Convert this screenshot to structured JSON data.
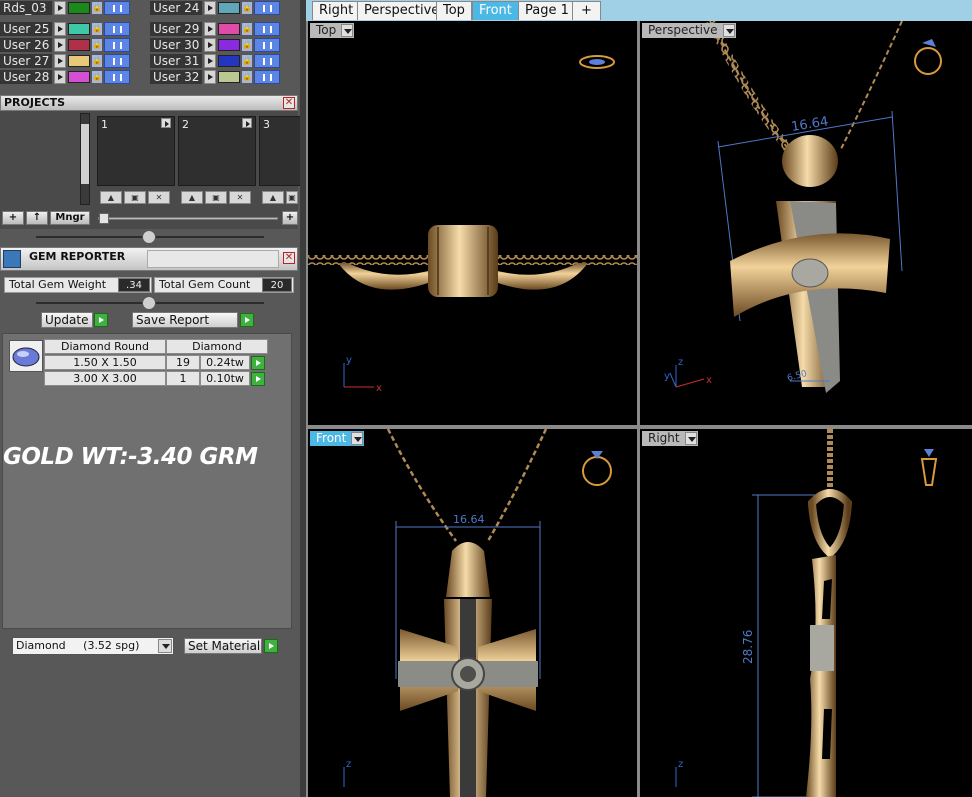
{
  "layers": [
    {
      "left": {
        "name": "Rds_03",
        "color": "#1a8a1a"
      },
      "right": {
        "name": "User 24",
        "color": "#5fa7b9"
      }
    },
    {
      "left": {
        "name": "User 25",
        "color": "#3fc8a8"
      },
      "right": {
        "name": "User 29",
        "color": "#e04aa8"
      }
    },
    {
      "left": {
        "name": "User 26",
        "color": "#b0304a"
      },
      "right": {
        "name": "User 30",
        "color": "#8a2ae0"
      }
    },
    {
      "left": {
        "name": "User 27",
        "color": "#e8c87a"
      },
      "right": {
        "name": "User 31",
        "color": "#2236c0"
      }
    },
    {
      "left": {
        "name": "User 28",
        "color": "#d44fd4"
      },
      "right": {
        "name": "User 32",
        "color": "#b8c890"
      }
    }
  ],
  "projects": {
    "title": "PROJECTS",
    "slots": [
      "1",
      "2",
      "3"
    ],
    "buttons": {
      "add": "+",
      "up": "↑",
      "manager": "Mngr",
      "plus": "+"
    }
  },
  "gem_reporter": {
    "title": "GEM REPORTER",
    "total_weight_label": "Total Gem Weight",
    "total_weight_value": ".34",
    "total_count_label": "Total Gem Count",
    "total_count_value": "20",
    "update_label": "Update",
    "save_report_label": "Save Report",
    "table": {
      "shape_header": "Diamond Round",
      "material_header": "Diamond",
      "rows": [
        {
          "size": "1.50 X 1.50",
          "count": "19",
          "weight": "0.24tw"
        },
        {
          "size": "3.00 X 3.00",
          "count": "1",
          "weight": "0.10tw"
        }
      ]
    },
    "gold_weight_text": "GOLD WT:-3.40 GRM",
    "material_select": "Diamond     (3.52 spg)",
    "set_material_label": "Set Material"
  },
  "tabs": [
    {
      "label": "Right",
      "active": false
    },
    {
      "label": "Perspective",
      "active": false
    },
    {
      "label": "Top",
      "active": false
    },
    {
      "label": "Front",
      "active": true
    },
    {
      "label": "Page 1",
      "active": false
    },
    {
      "label": "+",
      "active": false
    }
  ],
  "viewports": {
    "top": {
      "label": "Top"
    },
    "perspective": {
      "label": "Perspective",
      "dimension": "16.64",
      "dimension_small": "6.50"
    },
    "front": {
      "label": "Front",
      "dimension": "16.64"
    },
    "right": {
      "label": "Right",
      "dimension": "28.76"
    }
  },
  "axes": {
    "x": "x",
    "y": "y",
    "z": "z"
  },
  "colors": {
    "gold": "#c9a26a",
    "silver": "#a8a8a0",
    "dimension": "#4f78c8",
    "active_tab": "#4bb8e5"
  }
}
